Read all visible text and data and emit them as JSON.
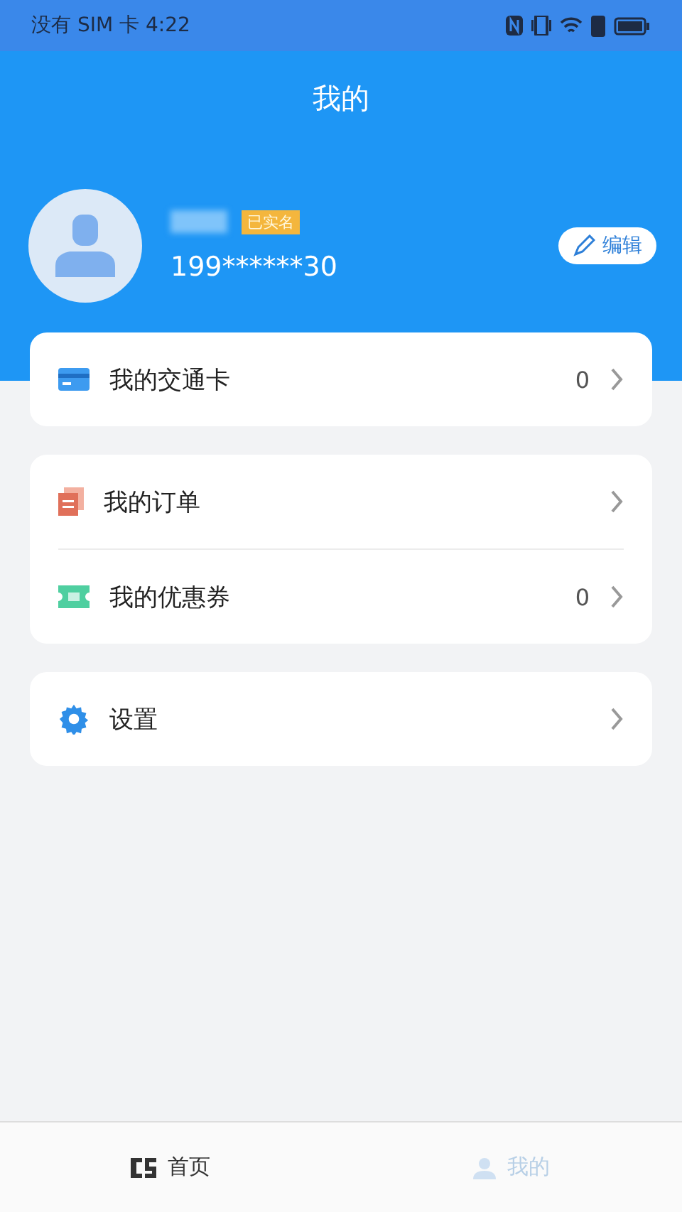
{
  "status_bar": {
    "carrier": "没有 SIM 卡",
    "time": "4:22"
  },
  "header": {
    "title": "我的"
  },
  "profile": {
    "badge": "已实名",
    "phone": "199******30",
    "edit_button": "编辑"
  },
  "groups": [
    {
      "items": [
        {
          "kind": "card",
          "label": "我的交通卡",
          "count": "0"
        }
      ]
    },
    {
      "items": [
        {
          "kind": "order",
          "label": "我的订单"
        },
        {
          "kind": "coupon",
          "label": "我的优惠券",
          "count": "0"
        }
      ]
    },
    {
      "items": [
        {
          "kind": "settings",
          "label": "设置"
        }
      ]
    }
  ],
  "tab_bar": [
    {
      "label": "首页",
      "selected": false
    },
    {
      "label": "我的",
      "selected": true
    }
  ]
}
